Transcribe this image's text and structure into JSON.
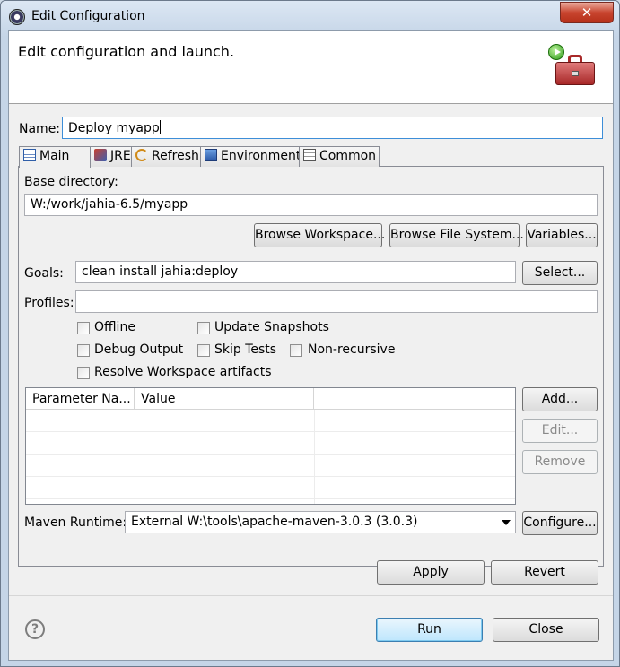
{
  "window": {
    "title": "Edit Configuration",
    "close_glyph": "✕"
  },
  "header": {
    "title": "Edit configuration and launch."
  },
  "name": {
    "label": "Name:",
    "value": "Deploy myapp"
  },
  "tabs": [
    {
      "label": "Main",
      "icon": "main-tab-icon"
    },
    {
      "label": "JRE",
      "icon": "jre-icon"
    },
    {
      "label": "Refresh",
      "icon": "refresh-icon"
    },
    {
      "label": "Environment",
      "icon": "environment-icon"
    },
    {
      "label": "Common",
      "icon": "common-icon"
    }
  ],
  "main": {
    "base_dir_label": "Base directory:",
    "base_dir_value": "W:/work/jahia-6.5/myapp",
    "browse_workspace": "Browse Workspace...",
    "browse_fs": "Browse File System...",
    "variables": "Variables...",
    "goals_label": "Goals:",
    "goals_value": "clean install jahia:deploy",
    "select": "Select...",
    "profiles_label": "Profiles:",
    "profiles_value": "",
    "options": {
      "offline": "Offline",
      "update_snapshots": "Update Snapshots",
      "debug_output": "Debug Output",
      "skip_tests": "Skip Tests",
      "non_recursive": "Non-recursive",
      "resolve_workspace": "Resolve Workspace artifacts"
    },
    "table": {
      "columns": [
        "Parameter Na...",
        "Value",
        ""
      ],
      "rows": []
    },
    "add": "Add...",
    "edit": "Edit...",
    "remove": "Remove",
    "runtime_label": "Maven Runtime:",
    "runtime_value": "External W:\\tools\\apache-maven-3.0.3 (3.0.3)",
    "configure": "Configure..."
  },
  "apply": "Apply",
  "revert": "Revert",
  "run": "Run",
  "close": "Close",
  "help_glyph": "?"
}
